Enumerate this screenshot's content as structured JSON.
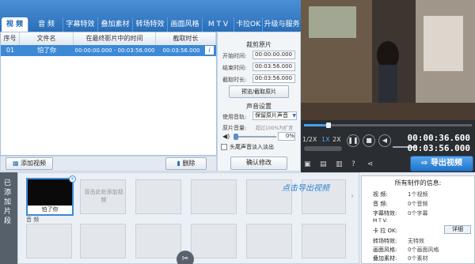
{
  "tabs": [
    "视 频",
    "音 频",
    "字幕特效",
    "叠加素材",
    "转场特效",
    "画面风格",
    "M T V",
    "卡拉OK",
    "升级与服务"
  ],
  "clip_table": {
    "headers": [
      "序号",
      "文件名",
      "在最终影片中的时间",
      "截取时长"
    ],
    "rows": [
      {
        "index": "01",
        "name": "怕了你",
        "range": "00:00:00.000 - 00:03:56.000",
        "duration": "00:03:56.000"
      }
    ]
  },
  "toolbar": {
    "add_video": "添加视频",
    "delete": "删除"
  },
  "edit_panel": {
    "crop_title": "裁剪原片",
    "start_label": "开始时间:",
    "start_value": "00:00:00.000",
    "end_label": "结束时间:",
    "end_value": "00:03:56.000",
    "dur_label": "截取时长:",
    "dur_value": "00:03:56.000",
    "preview_btn": "预览/截取原片",
    "audio_title": "声音设置",
    "track_label": "使用音轨:",
    "track_value": "保留原片声音",
    "vol_label": "原片音量:",
    "vol_hint": "超过100%为扩音",
    "vol_value": "0%",
    "fade_label": "头尾声音淡入淡出",
    "confirm_btn": "确认修改"
  },
  "player": {
    "speeds": [
      "1/2X",
      "1X",
      "2X"
    ],
    "time_current": "00:00:36.600",
    "time_total": "00:03:56.000",
    "export_label": "导出视频",
    "hint": "点击导出视频"
  },
  "timeline": {
    "side_label": "已添加片段",
    "clip_label": "怕了你",
    "add_hint": "双击此处添加视频",
    "audio_label": "音 频"
  },
  "info": {
    "title": "所有制作的信息:",
    "rows": [
      {
        "label": "视   频:",
        "value": "1个视频"
      },
      {
        "label": "音   频:",
        "value": "0个音频"
      },
      {
        "label": "字幕特效:",
        "value": "0个字幕"
      },
      {
        "label": "M   T   V:",
        "value": ""
      },
      {
        "label": "卡 拉 OK:",
        "value": ""
      },
      {
        "label": "转场特效:",
        "value": "无特效"
      },
      {
        "label": "画面风格:",
        "value": "0个画面风格"
      },
      {
        "label": "叠加素材:",
        "value": "0个素材"
      }
    ],
    "detail_btn": "详细"
  }
}
